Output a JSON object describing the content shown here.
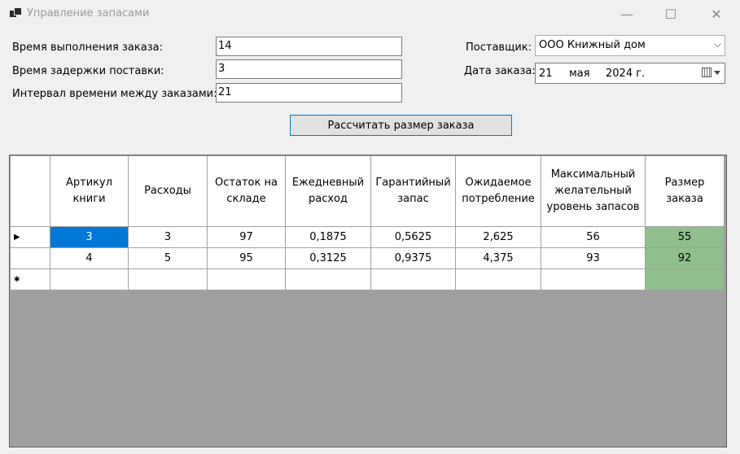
{
  "window": {
    "title": "Управление запасами",
    "minimize_glyph": "—",
    "maximize_glyph": "☐",
    "close_glyph": "✕"
  },
  "form": {
    "lead_time_label": "Время выполнения заказа:",
    "lead_time_value": "14",
    "delay_label": "Время задержки поставки:",
    "delay_value": "3",
    "interval_label": "Интервал времени между заказами:",
    "interval_value": "21",
    "supplier_label": "Поставщик:",
    "supplier_value": "ООО Книжный дом",
    "order_date_label": "Дата заказа:",
    "order_date_day": "21",
    "order_date_month": "мая",
    "order_date_year": "2024 г.",
    "calculate_button": "Рассчитать размер заказа"
  },
  "table": {
    "headers": [
      "Артикул книги",
      "Расходы",
      "Остаток на складе",
      "Ежедневный расход",
      "Гарантийный запас",
      "Ожидаемое потребление",
      "Максимальный желательный уровень запасов",
      "Размер заказа"
    ],
    "rows": [
      [
        "3",
        "3",
        "97",
        "0,1875",
        "0,5625",
        "2,625",
        "56",
        "55"
      ],
      [
        "4",
        "5",
        "95",
        "0,3125",
        "0,9375",
        "4,375",
        "93",
        "92"
      ]
    ],
    "current_row_marker": "▶",
    "new_row_marker": "✱"
  },
  "colors": {
    "selection": "#0078d7",
    "order_size_cell": "#8fbf8c",
    "grid_background": "#a0a0a0"
  }
}
